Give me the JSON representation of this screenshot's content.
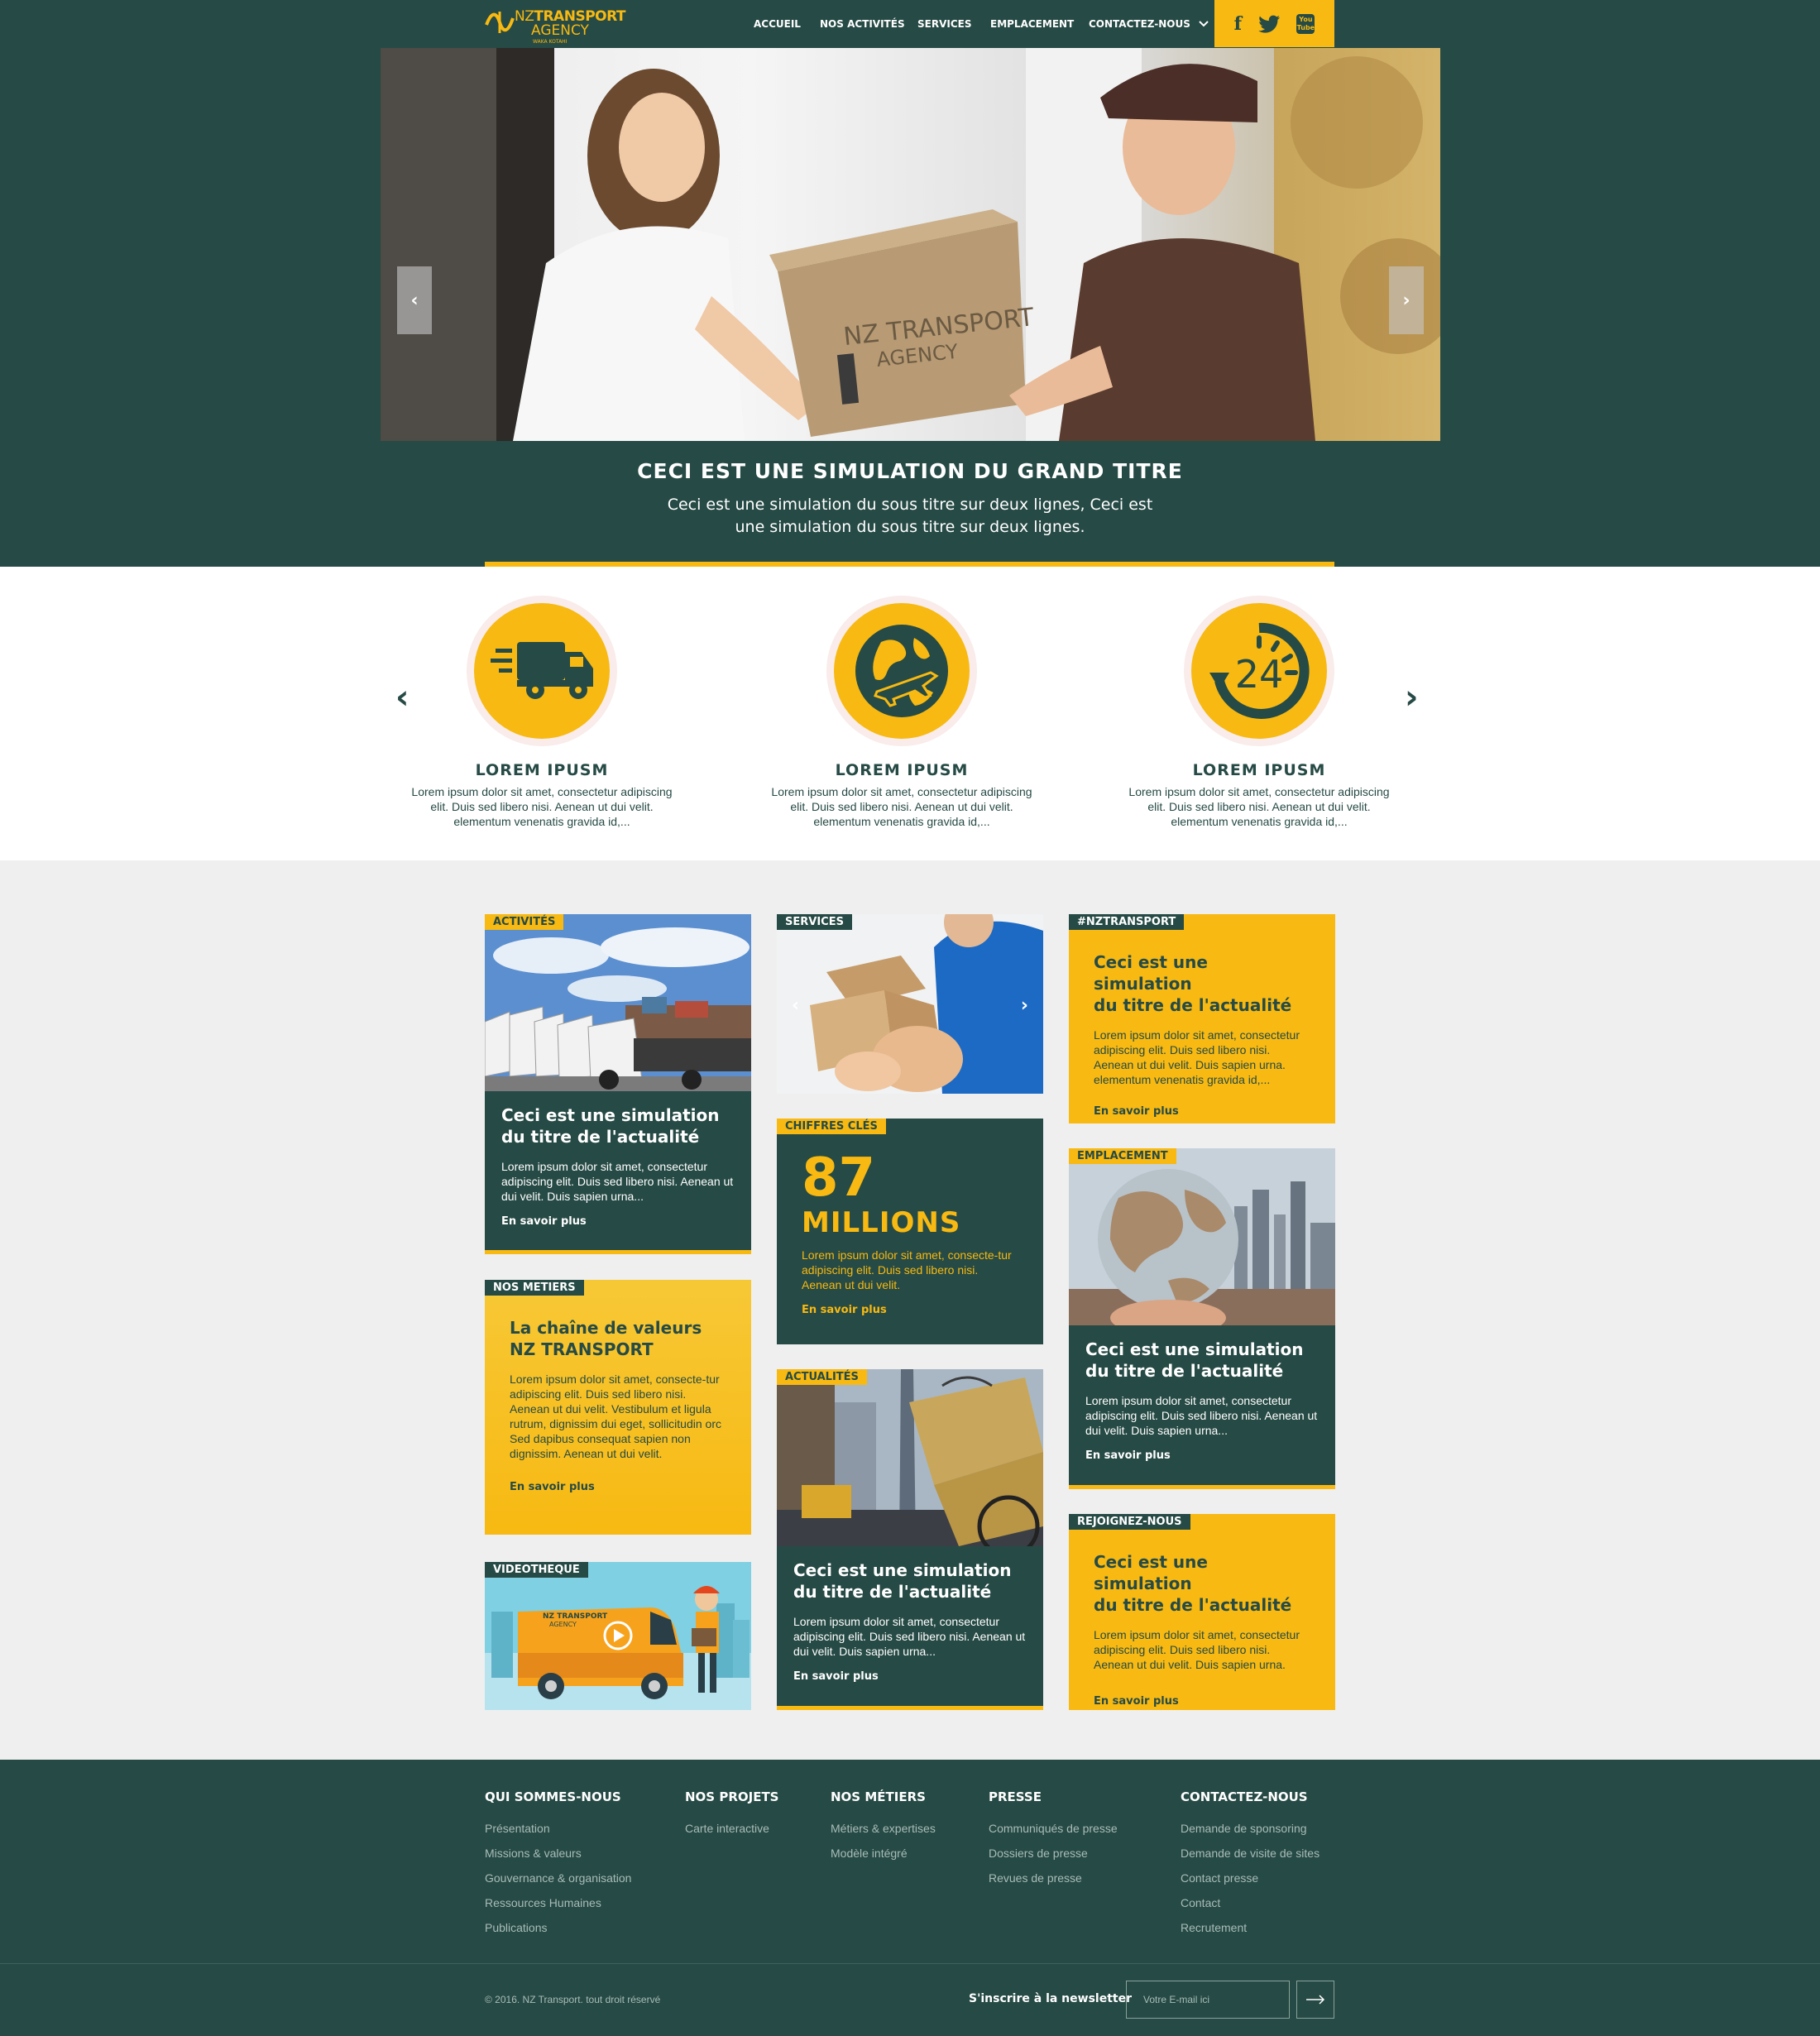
{
  "brand": {
    "logo_line1_a": "NZ",
    "logo_line1_b": "TRANSPORT",
    "logo_line2": "AGENCY",
    "logo_line3": "WAKA KOTAHI",
    "colors": {
      "green": "#264a45",
      "yellow": "#f7b912",
      "white": "#ffffff",
      "light_grey": "#efefef"
    }
  },
  "nav": {
    "items": [
      {
        "label": "ACCUEIL"
      },
      {
        "label": "NOS ACTIVITÉS"
      },
      {
        "label": "SERVICES"
      },
      {
        "label": "EMPLACEMENT"
      },
      {
        "label": "CONTACTEZ-NOUS"
      }
    ],
    "social": [
      {
        "icon": "facebook-icon",
        "glyph": "f"
      },
      {
        "icon": "twitter-icon",
        "glyph": "t"
      },
      {
        "icon": "youtube-icon",
        "glyph": "You Tube"
      }
    ]
  },
  "hero": {
    "box_text_1": "NZ TRANSPORT",
    "box_text_2": "AGENCY",
    "title": "CECI EST UNE SIMULATION DU GRAND TITRE",
    "subtitle": "Ceci est une simulation du sous titre sur deux lignes, Ceci est une simulation du sous titre sur deux lignes."
  },
  "services": [
    {
      "icon": "delivery-truck-icon",
      "title": "LOREM IPUSM",
      "text": "Lorem ipsum dolor sit amet, consectetur adipiscing elit. Duis sed libero nisi. Aenean ut dui velit. elementum venenatis gravida id,..."
    },
    {
      "icon": "globe-plane-icon",
      "title": "LOREM IPUSM",
      "text": "Lorem ipsum dolor sit amet, consectetur adipiscing elit. Duis sed libero nisi. Aenean ut dui velit. elementum venenatis gravida id,..."
    },
    {
      "icon": "clock-24-icon",
      "title": "LOREM IPUSM",
      "text": "Lorem ipsum dolor sit amet, consectetur adipiscing elit. Duis sed libero nisi. Aenean ut dui velit. elementum venenatis gravida id,...",
      "badge": "24"
    }
  ],
  "cards": {
    "activites": {
      "tag": "ACTIVITÉS",
      "title1": "Ceci est une simulation",
      "title2": "du titre de l'actualité",
      "text": "Lorem ipsum dolor sit amet, consectetur adipiscing elit. Duis sed libero nisi. Aenean ut dui velit. Duis sapien urna...",
      "more": "En savoir plus"
    },
    "metiers": {
      "tag": "NOS METIERS",
      "title1": "La chaîne de valeurs",
      "title2": "NZ TRANSPORT",
      "text": "Lorem ipsum dolor sit amet, consecte-tur adipiscing elit. Duis sed libero nisi. Aenean ut dui velit. Vestibulum et ligula rutrum, dignissim dui eget, sollicitudin orc Sed dapibus consequat sapien non dignissim. Aenean ut dui velit.",
      "more": "En savoir plus"
    },
    "video": {
      "tag": "VIDEOTHEQUE",
      "van_text_1": "NZ TRANSPORT",
      "van_text_2": "AGENCY"
    },
    "services": {
      "tag": "SERVICES"
    },
    "chiffres": {
      "tag": "CHIFFRES CLÉS",
      "number": "87",
      "unit": "MILLIONS",
      "text": "Lorem ipsum dolor sit amet, consecte-tur adipiscing elit. Duis sed libero nisi. Aenean ut dui velit.",
      "more": "En savoir plus"
    },
    "actualites": {
      "tag": "ACTUALITÉS",
      "title1": "Ceci est une simulation",
      "title2": "du titre de l'actualité",
      "text": "Lorem ipsum dolor sit amet, consectetur adipiscing elit. Duis sed libero nisi. Aenean ut dui velit. Duis sapien urna...",
      "more": "En savoir plus"
    },
    "nztransport": {
      "tag": "#NZTRANSPORT",
      "title1": "Ceci est une simulation",
      "title2": "du titre de l'actualité",
      "text": "Lorem ipsum dolor sit amet, consectetur adipiscing elit. Duis sed libero nisi. Aenean ut dui velit. Duis sapien urna. elementum venenatis gravida id,...",
      "more": "En savoir plus"
    },
    "emplacement": {
      "tag": "EMPLACEMENT",
      "title1": "Ceci est une simulation",
      "title2": "du titre de l'actualité",
      "text": "Lorem ipsum dolor sit amet, consectetur adipiscing elit. Duis sed libero nisi. Aenean ut dui velit. Duis sapien urna...",
      "more": "En savoir plus"
    },
    "rejoignez": {
      "tag": "REJOIGNEZ-NOUS",
      "title1": "Ceci est une simulation",
      "title2": "du titre de l'actualité",
      "text": "Lorem ipsum dolor sit amet, consectetur adipiscing elit. Duis sed libero nisi. Aenean ut dui velit. Duis sapien urna.",
      "more": "En savoir plus"
    }
  },
  "footer": {
    "columns": [
      {
        "heading": "QUI SOMMES-NOUS",
        "links": [
          "Présentation",
          "Missions & valeurs",
          "Gouvernance & organisation",
          "Ressources Humaines",
          "Publications"
        ]
      },
      {
        "heading": "NOS PROJETS",
        "links": [
          "Carte interactive"
        ]
      },
      {
        "heading": "NOS MÉTIERS",
        "links": [
          "Métiers & expertises",
          "Modèle intégré"
        ]
      },
      {
        "heading": "PRESSE",
        "links": [
          "Communiqués de presse",
          "Dossiers de presse",
          "Revues de presse"
        ]
      },
      {
        "heading": "CONTACTEZ-NOUS",
        "links": [
          "Demande de sponsoring",
          "Demande de visite de sites",
          "Contact presse",
          "Contact",
          "Recrutement"
        ]
      }
    ],
    "copyright": "© 2016. NZ Transport. tout droit réservé",
    "newsletter_label": "S'inscrire à la newsletter",
    "newsletter_placeholder": "Votre E-mail ici"
  }
}
